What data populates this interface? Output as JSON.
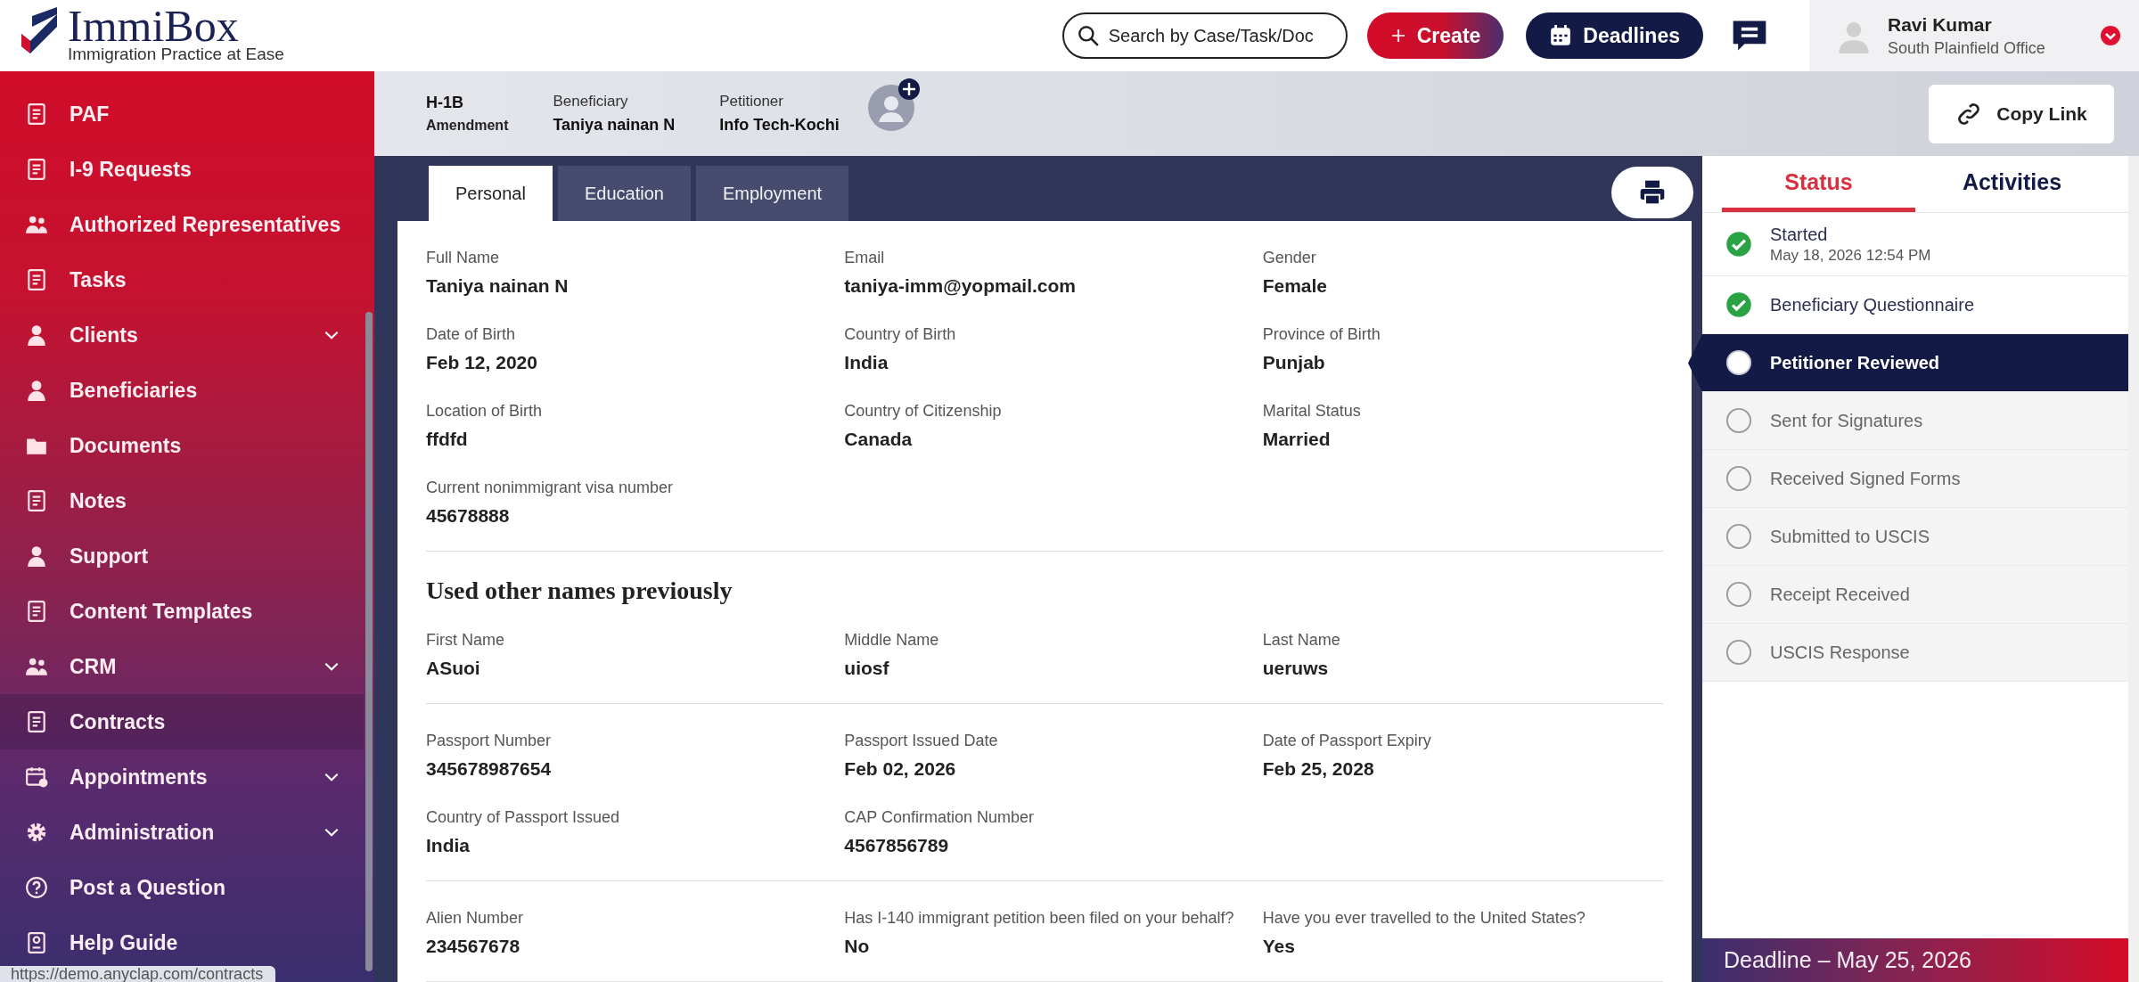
{
  "logo": {
    "name": "ImmiBox",
    "tagline": "Immigration Practice at Ease"
  },
  "sidebar": {
    "items": [
      {
        "label": "PAF",
        "expandable": false,
        "hovered": false
      },
      {
        "label": "I-9 Requests",
        "expandable": false,
        "hovered": false
      },
      {
        "label": "Authorized Representatives",
        "expandable": false,
        "hovered": false
      },
      {
        "label": "Tasks",
        "expandable": false,
        "hovered": false
      },
      {
        "label": "Clients",
        "expandable": true,
        "hovered": false
      },
      {
        "label": "Beneficiaries",
        "expandable": false,
        "hovered": false
      },
      {
        "label": "Documents",
        "expandable": false,
        "hovered": false
      },
      {
        "label": "Notes",
        "expandable": false,
        "hovered": false
      },
      {
        "label": "Support",
        "expandable": false,
        "hovered": false
      },
      {
        "label": "Content Templates",
        "expandable": false,
        "hovered": false
      },
      {
        "label": "CRM",
        "expandable": true,
        "hovered": false
      },
      {
        "label": "Contracts",
        "expandable": false,
        "hovered": true
      },
      {
        "label": "Appointments",
        "expandable": true,
        "hovered": false
      },
      {
        "label": "Administration",
        "expandable": true,
        "hovered": false
      },
      {
        "label": "Post a Question",
        "expandable": false,
        "hovered": false
      },
      {
        "label": "Help Guide",
        "expandable": false,
        "hovered": false
      }
    ]
  },
  "search": {
    "placeholder": "Search by Case/Task/Doc"
  },
  "header_buttons": [
    {
      "kind": "create",
      "label": "Create"
    },
    {
      "kind": "deadlines",
      "label": "Deadlines"
    }
  ],
  "user": {
    "name": "Ravi Kumar",
    "office": "South Plainfield Office"
  },
  "case": {
    "type": "H-1B",
    "subtype": "Amendment",
    "parties": [
      {
        "label": "Beneficiary",
        "value": "Taniya nainan N"
      },
      {
        "label": "Petitioner",
        "value": "Info Tech-Kochi"
      }
    ]
  },
  "copy_link": "Copy Link",
  "tabs": [
    {
      "label": "Personal",
      "selected": true
    },
    {
      "label": "Education",
      "selected": false
    },
    {
      "label": "Employment",
      "selected": false
    }
  ],
  "groups": [
    {
      "fields": [
        {
          "label": "Full Name",
          "value": "Taniya nainan N"
        },
        {
          "label": "Email",
          "value": "taniya-imm@yopmail.com"
        },
        {
          "label": "Gender",
          "value": "Female"
        },
        {
          "label": "Date of Birth",
          "value": "Feb 12, 2020"
        },
        {
          "label": "Country of Birth",
          "value": "India"
        },
        {
          "label": "Province of Birth",
          "value": "Punjab"
        },
        {
          "label": "Location of Birth",
          "value": "ffdfd"
        },
        {
          "label": "Country of Citizenship",
          "value": "Canada"
        },
        {
          "label": "Marital Status",
          "value": "Married"
        },
        {
          "label": "Current nonimmigrant visa number",
          "value": "45678888"
        }
      ]
    },
    {
      "title": "Used other names previously",
      "fields": [
        {
          "label": "First Name",
          "value": "ASuoi"
        },
        {
          "label": "Middle Name",
          "value": "uiosf"
        },
        {
          "label": "Last Name",
          "value": "ueruws"
        }
      ]
    },
    {
      "fields": [
        {
          "label": "Passport Number",
          "value": "345678987654"
        },
        {
          "label": "Passport Issued Date",
          "value": "Feb 02, 2026"
        },
        {
          "label": "Date of Passport Expiry",
          "value": "Feb 25, 2028"
        },
        {
          "label": "Country of Passport Issued",
          "value": "India"
        },
        {
          "label": "CAP Confirmation Number",
          "value": "4567856789"
        }
      ]
    },
    {
      "fields": [
        {
          "label": "Alien Number",
          "value": "234567678"
        },
        {
          "label": "Has I-140 immigrant petition been filed on your behalf?",
          "value": "No"
        },
        {
          "label": "Have you ever travelled to the United States?",
          "value": "Yes"
        }
      ]
    }
  ],
  "status_panel": {
    "tabs": [
      {
        "label": "Status",
        "selected": true
      },
      {
        "label": "Activities",
        "selected": false
      }
    ],
    "steps": [
      {
        "label": "Started",
        "date": "May 18, 2026 12:54 PM",
        "completed": true,
        "selected": false
      },
      {
        "label": "Beneficiary Questionnaire",
        "completed": true,
        "selected": false
      },
      {
        "label": "Petitioner Reviewed",
        "completed": false,
        "selected": true
      },
      {
        "label": "Sent for Signatures",
        "completed": false,
        "selected": false
      },
      {
        "label": "Received Signed Forms",
        "completed": false,
        "selected": false
      },
      {
        "label": "Submitted to USCIS",
        "completed": false,
        "selected": false
      },
      {
        "label": "Receipt Received",
        "completed": false,
        "selected": false
      },
      {
        "label": "USCIS Response",
        "completed": false,
        "selected": false
      }
    ],
    "deadline": "Deadline – May 25, 2026"
  },
  "status_url": "https://demo.anyclap.com/contracts"
}
